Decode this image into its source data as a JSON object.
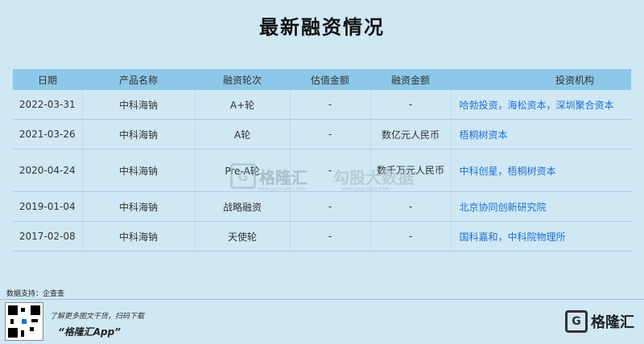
{
  "title": "最新融资情况",
  "table": {
    "headers": [
      "日期",
      "产品名称",
      "融资轮次",
      "估值金额",
      "融资金额",
      "投资机构"
    ],
    "rows": [
      {
        "date": "2022-03-31",
        "product": "中科海钠",
        "round": "A+轮",
        "valuation": "-",
        "amount": "-",
        "investors": "哈勃投资，海松资本，深圳聚合资本"
      },
      {
        "date": "2021-03-26",
        "product": "中科海钠",
        "round": "A轮",
        "valuation": "-",
        "amount": "数亿元人民币",
        "investors": "梧桐树资本"
      },
      {
        "date": "2020-04-24",
        "product": "中科海钠",
        "round": "Pre-A轮",
        "valuation": "-",
        "amount": "数千万元人民币",
        "investors": "中科创星，梧桐树资本"
      },
      {
        "date": "2019-01-04",
        "product": "中科海钠",
        "round": "战略融资",
        "valuation": "-",
        "amount": "-",
        "investors": "北京协同创新研究院"
      },
      {
        "date": "2017-02-08",
        "product": "中科海钠",
        "round": "天使轮",
        "valuation": "-",
        "amount": "-",
        "investors": "国科嘉和，中科院物理所"
      }
    ]
  },
  "watermark": {
    "logo_letter": "G",
    "brand": "格隆汇",
    "brand_url": "www.gelonghui.com",
    "partner": "勾股大数据",
    "partner_url": "www.gogudata.com"
  },
  "source": "数据支持：企查查",
  "footer": {
    "promo_line": "了解更多图文干货，扫码下载",
    "app_name": "“格隆汇App”",
    "brand_letter": "G",
    "brand_name": "格隆汇"
  },
  "colors": {
    "background": "#cfe8f4",
    "header": "#8dc8e8",
    "link": "#1f6fcf"
  }
}
